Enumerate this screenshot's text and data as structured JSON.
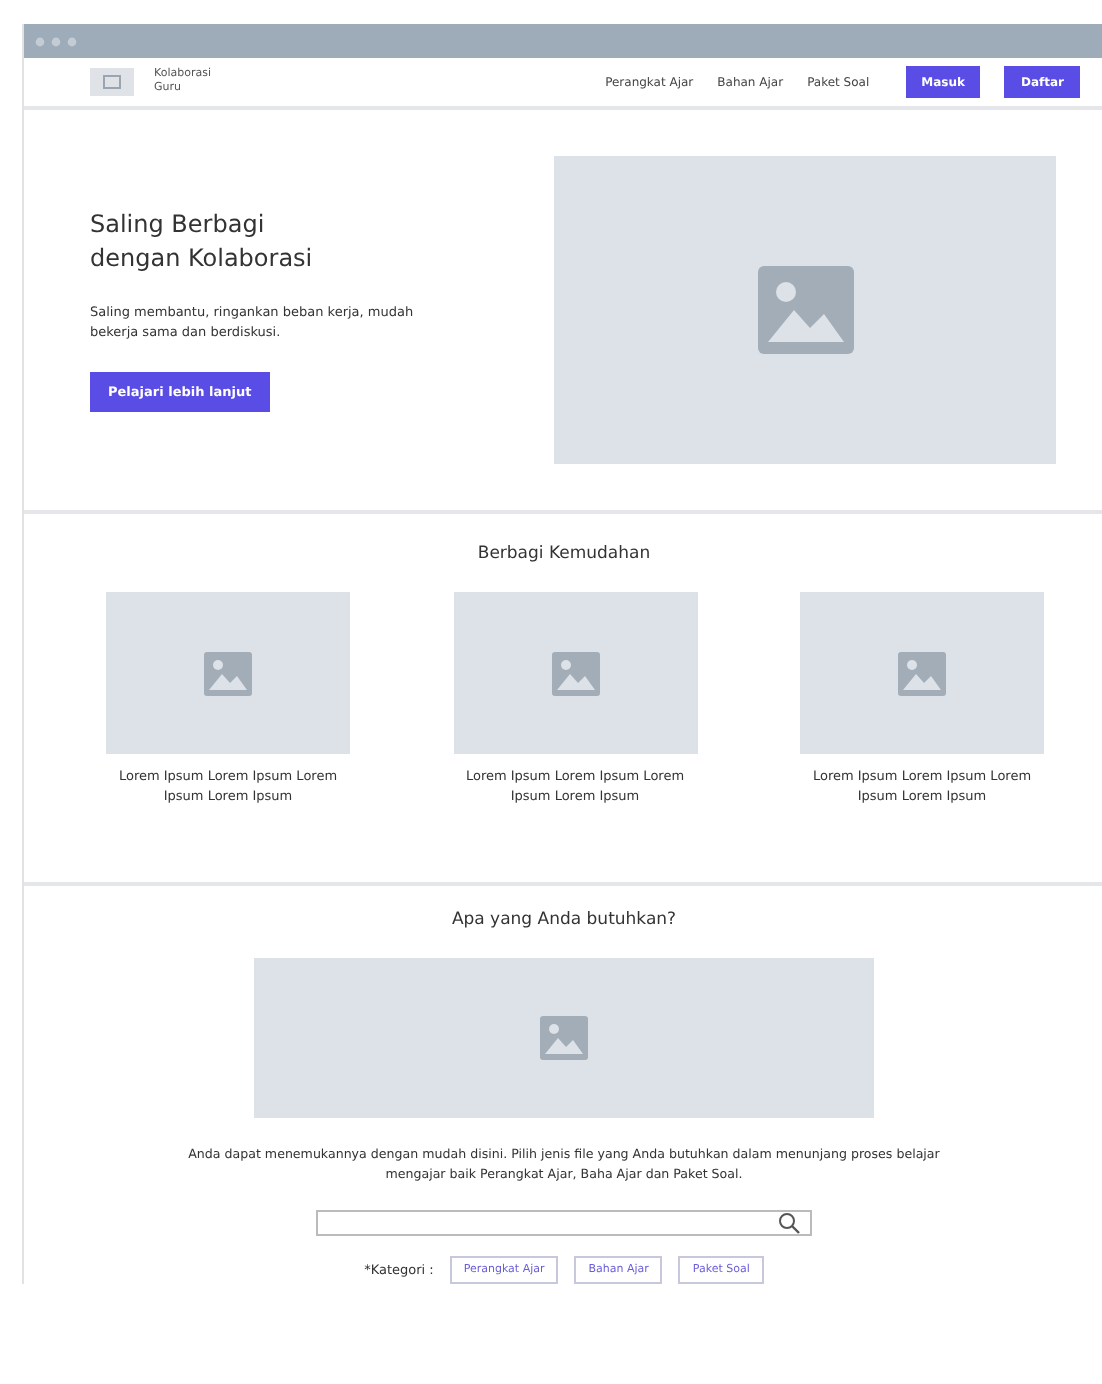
{
  "brand": {
    "name": "Kolaborasi Guru"
  },
  "nav": {
    "links": [
      "Perangkat Ajar",
      "Bahan Ajar",
      "Paket Soal"
    ],
    "buttons": [
      "Masuk",
      "Daftar"
    ]
  },
  "hero": {
    "title": "Saling Berbagi dengan Kolaborasi",
    "text": "Saling membantu, ringankan beban kerja, mudah bekerja sama dan berdiskusi.",
    "button": "Pelajari lebih lanjut"
  },
  "features": {
    "title": "Berbagi Kemudahan",
    "items": [
      {
        "caption": "Lorem Ipsum Lorem Ipsum Lorem Ipsum Lorem Ipsum"
      },
      {
        "caption": "Lorem Ipsum Lorem Ipsum Lorem Ipsum Lorem Ipsum"
      },
      {
        "caption": "Lorem Ipsum Lorem Ipsum Lorem Ipsum Lorem Ipsum"
      }
    ]
  },
  "search_section": {
    "title": "Apa yang Anda butuhkan?",
    "text": "Anda dapat menemukannya dengan mudah disini. Pilih jenis file yang Anda butuhkan dalam menunjang proses belajar mengajar baik Perangkat Ajar, Baha Ajar dan Paket Soal.",
    "category_label": "*Kategori :",
    "categories": [
      "Perangkat Ajar",
      "Bahan Ajar",
      "Paket Soal"
    ]
  }
}
